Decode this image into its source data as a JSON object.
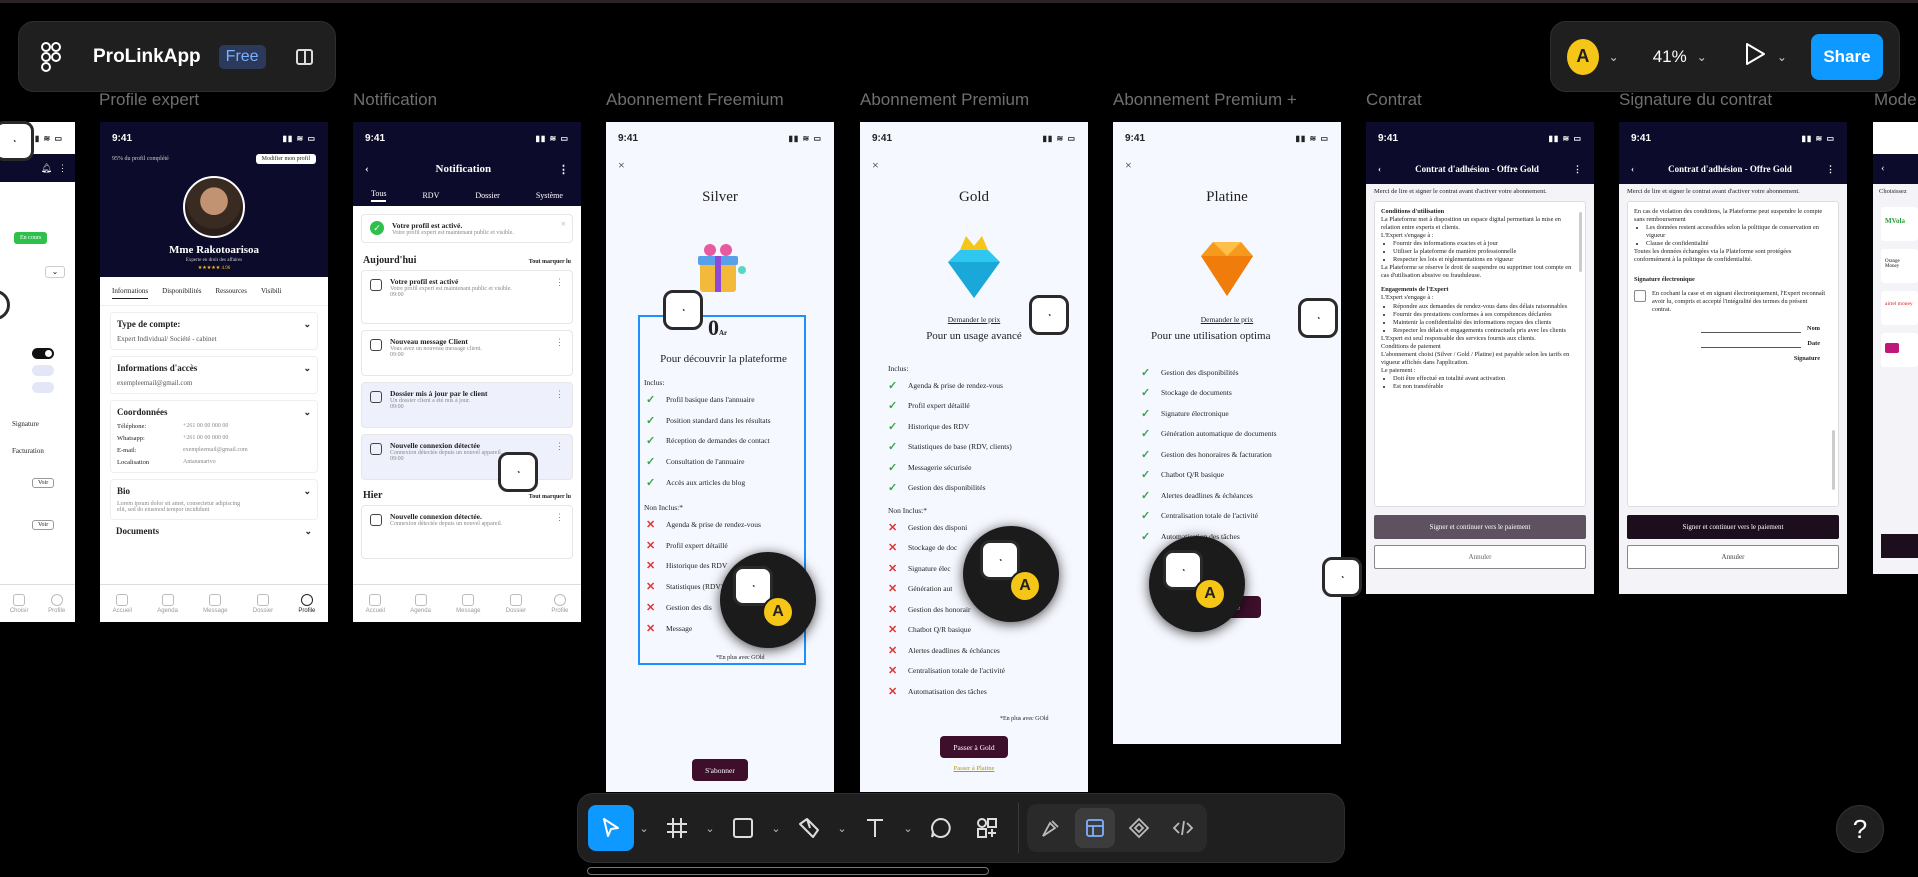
{
  "app": {
    "name": "ProLinkApp",
    "plan": "Free"
  },
  "header_right": {
    "avatar_initial": "A",
    "zoom": "41%",
    "share_label": "Share"
  },
  "frame_labels": {
    "profile_expert": "Profile expert",
    "notification": "Notification",
    "freemium": "Abonnement Freemium",
    "premium": "Abonnement Premium",
    "premium_plus": "Abonnement Premium +",
    "contrat": "Contrat",
    "signature": "Signature du contrat",
    "mode": "Mode"
  },
  "status_time": "9:41",
  "frame0": {
    "badge": "En cours",
    "signature": "Signature",
    "facturation": "Facturation",
    "voir": "Voir",
    "nav": [
      "Choisir",
      "Profile"
    ]
  },
  "profile": {
    "completion": "95% du profil complété",
    "edit_button": "Modifier mon profil",
    "name": "Mme Rakotoarisoa",
    "subtitle": "Experte en droit des affaires",
    "rating": "★★★★★ 4.96",
    "tabs": [
      "Informations",
      "Disponibilités",
      "Ressources",
      "Visibili"
    ],
    "account_type_title": "Type de compte:",
    "account_type_value": "Expert Individual/ Société - cabinet",
    "access_title": "Informations d'accès",
    "access_value": "exempleemail@gmail.com",
    "coords_title": "Coordonnées",
    "coords": [
      {
        "label": "Téléphone:",
        "value": "+261 00 00 000 00"
      },
      {
        "label": "Whatsapp:",
        "value": "+261 00 00 000 00"
      },
      {
        "label": "E-mail:",
        "value": "exempleemail@gmail.com"
      },
      {
        "label": "Localisation",
        "value": "Antananarivo"
      }
    ],
    "bio_title": "Bio",
    "bio_text": "Lorem ipsum dolor sit amet, consectetur adipiscing elit, sed do eiusmod tempor incididunt",
    "documents_title": "Documents",
    "nav": [
      "Accueil",
      "Agenda",
      "Message",
      "Dossier",
      "Profile"
    ]
  },
  "notification": {
    "title": "Notification",
    "tabs": [
      "Tous",
      "RDV",
      "Dossier",
      "Système"
    ],
    "banner_title": "Votre profil est activé.",
    "banner_text": "Votre profil expert est maintenant public et visible.",
    "today": "Aujourd'hui",
    "mark_read": "Tout marquer lu",
    "items_today": [
      {
        "title": "Votre profil est activé",
        "text": "Votre profil expert est maintenant public et visible.",
        "time": "09:00"
      },
      {
        "title": "Nouveau message Client",
        "text": "Vous avez un nouveau message client.",
        "time": "09:00"
      },
      {
        "title": "Dossier mis à jour par le client",
        "text": "Un dossier client a été mis à jour.",
        "time": "09:00"
      },
      {
        "title": "Nouvelle connexion détectée",
        "text": "Connexion détectée depuis un nouvel appareil.",
        "time": "09:00"
      }
    ],
    "yesterday": "Hier",
    "items_yesterday": [
      {
        "title": "Nouvelle connexion détectée.",
        "text": "Connexion détectée depuis un nouvel appareil.",
        "time": ""
      }
    ],
    "nav": [
      "Accueil",
      "Agenda",
      "Message",
      "Dossier",
      "Profile"
    ]
  },
  "silver": {
    "title": "Silver",
    "price": "0",
    "currency": "Ar",
    "tagline": "Pour découvrir la plateforme",
    "included_label": "Inclus:",
    "included": [
      "Profil basique dans l'annuaire",
      "Position standard dans les résultats",
      "Réception de demandes de contact",
      "Consultation de l'annuaire",
      "Accès aux articles du blog"
    ],
    "excluded_label": "Non Inclus:*",
    "excluded": [
      "Agenda & prise de rendez-vous",
      "Profil expert détaillé",
      "Historique des RDV",
      "Statistiques (RDV)",
      "Gestion des dis",
      "Message"
    ],
    "footnote": "*En plus avec GOld",
    "cta": "S'abonner"
  },
  "gold": {
    "title": "Gold",
    "price_link": "Demander le prix",
    "tagline": "Pour un usage avancé",
    "included_label": "Inclus:",
    "included": [
      "Agenda & prise de rendez-vous",
      "Profil expert détaillé",
      "Historique des RDV",
      "Statistiques de base (RDV, clients)",
      "Messagerie sécurisée",
      "Gestion des disponibilités"
    ],
    "excluded_label": "Non Inclus:*",
    "excluded": [
      "Gestion des disponi",
      "Stockage de doc",
      "Signature élec",
      "Génération aut",
      "Gestion des honorair",
      "Chatbot Q/R basique",
      "Alertes deadlines & échéances",
      "Centralisation totale de l'activité",
      "Automatisation des tâches"
    ],
    "footnote": "*En plus avec GOld",
    "cta": "Passer à Gold",
    "secondary": "Passer à Platine"
  },
  "platine": {
    "title": "Platine",
    "price_link": "Demander le prix",
    "tagline": "Pour une utilisation optima",
    "included": [
      "Gestion des disponibilités",
      "Stockage de documents",
      "Signature électronique",
      "Génération automatique de documents",
      "Gestion des honoraires & facturation",
      "Chatbot Q/R basique",
      "Alertes deadlines & échéances",
      "Centralisation totale de l'activité",
      "Automatisation des tâches"
    ],
    "cta": "istine"
  },
  "contrat": {
    "title": "Contrat d'adhésion - Offre Gold",
    "intro": "Merci de lire et signer le contrat avant d'activer votre abonnement.",
    "conditions_title": "Conditions d'utilisation",
    "conditions_text": "La Plateforme met à disposition un espace digital permettant la mise en relation entre experts et clients.",
    "expert_engage": "L'Expert s'engage à :",
    "bullets1": [
      "Fournir des informations exactes et à jour",
      "Utiliser la plateforme de manière professionnelle",
      "Respecter les lois et réglementations en vigueur"
    ],
    "suspend_text": "La Plateforme se réserve le droit de suspendre ou supprimer tout compte en cas d'utilisation abusive ou frauduleuse.",
    "engagements_title": "Engagements de l'Expert",
    "bullets2": [
      "Répondre aux demandes de rendez-vous dans des délais raisonnables",
      "Fournir des prestations conformes à ses compétences déclarées",
      "Maintenir la confidentialité des informations reçues des clients",
      "Respecter les délais et engagements contractuels pris avec les clients"
    ],
    "responsable": "L'Expert est seul responsable des services fournis aux clients.",
    "paiement_title": "Conditions de paiement",
    "paiement_text": "L'abonnement choisi (Silver / Gold / Platine) est payable selon les tarifs en vigueur affichés dans l'application.",
    "le_paiement": "Le paiement :",
    "bullets3": [
      "Doit être effectué en totalité avant activation",
      "Est non transférable"
    ],
    "primary": "Signer et continuer vers le paiement",
    "secondary": "Annuler"
  },
  "signature": {
    "title": "Contrat d'adhésion - Offre Gold",
    "intro": "Merci de lire et signer le contrat avant d'activer votre abonnement.",
    "text1": "En cas de violation des conditions, la Plateforme peut suspendre le compte sans remboursement",
    "bullets": [
      "Les données restent accessibles selon la politique de conservation en vigueur",
      "Clause de confidentialité"
    ],
    "text2": "Toutes les données échangées via la Plateforme sont protégées conformément à la politique de confidentialité.",
    "sig_title": "Signature électronique",
    "checkbox_text": "En cochant la case et en signant électroniquement, l'Expert reconnaît avoir lu, compris et accepté l'intégralité des termes du présent contrat.",
    "fields": [
      "Nom",
      "Date",
      "Signature"
    ],
    "primary": "Signer et continuer vers le paiement",
    "secondary": "Annuler"
  },
  "mode": {
    "intro": "Choisissez",
    "items": [
      "MVola",
      "Orange Money",
      "airtel money",
      ""
    ]
  },
  "tools": [
    "move-tool",
    "frame-tool",
    "shape-tool",
    "pen-tool",
    "text-tool",
    "comment-tool",
    "actions-tool"
  ],
  "help": "?"
}
